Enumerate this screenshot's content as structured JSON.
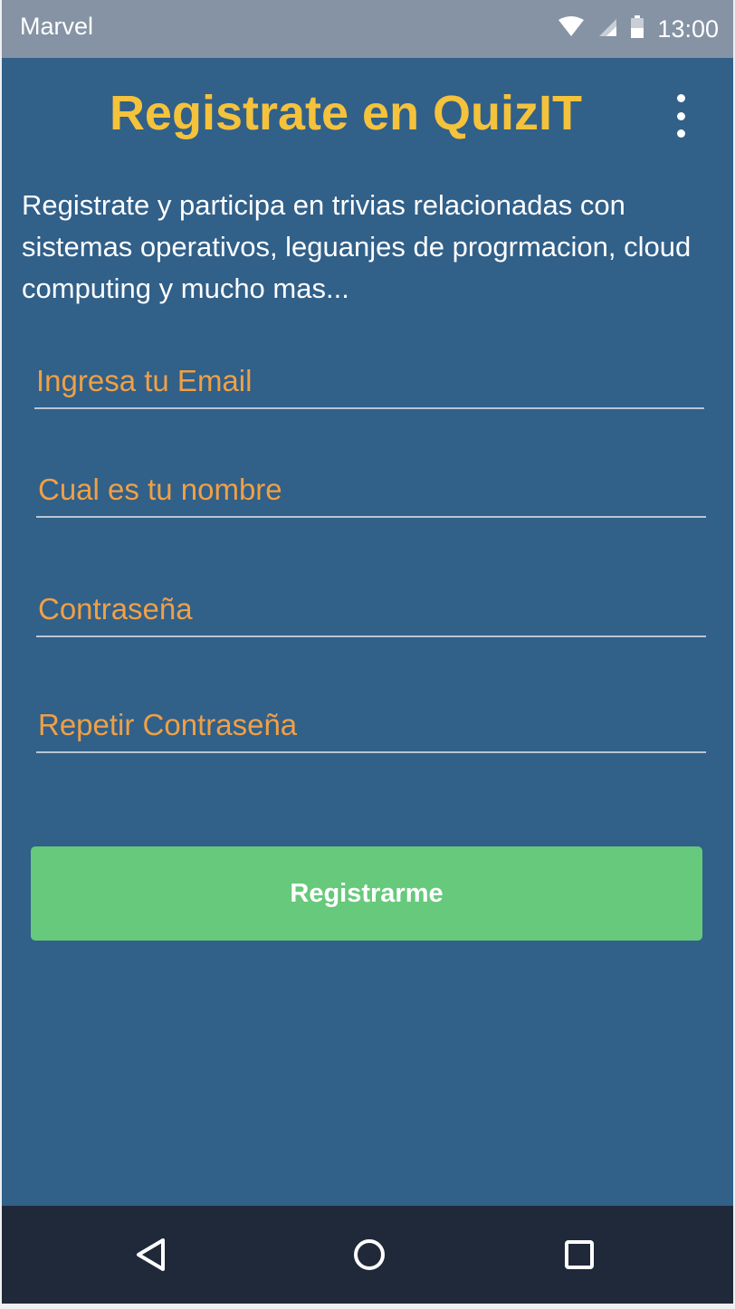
{
  "status_bar": {
    "carrier": "Marvel",
    "time": "13:00",
    "icons": [
      "wifi-icon",
      "signal-icon",
      "battery-icon"
    ]
  },
  "app": {
    "title": "Registrate en QuizIT",
    "menu_icon": "more-vert-icon",
    "description": "Registrate y participa en trivias relacionadas con sistemas operativos, leguanjes de progrmacion, cloud computing y mucho mas..."
  },
  "form": {
    "email_placeholder": "Ingresa tu Email",
    "name_placeholder": "Cual es tu nombre",
    "password_placeholder": "Contraseña",
    "repeat_password_placeholder": "Repetir Contraseña",
    "register_label": "Registrarme"
  },
  "nav_bar": {
    "icons": [
      "back-icon",
      "home-icon",
      "recents-icon"
    ]
  },
  "colors": {
    "background": "#316089",
    "status_bar": "#8593a4",
    "title": "#f5c23c",
    "placeholder": "#f0a045",
    "button": "#66c97b",
    "nav_bar": "#20293a"
  }
}
